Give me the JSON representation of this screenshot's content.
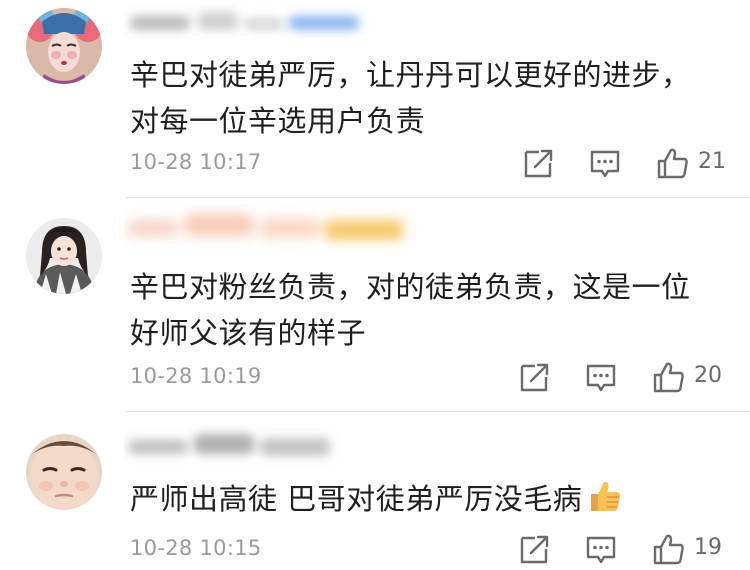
{
  "comments": [
    {
      "text_line1": "辛巴对徒弟严厉，让丹丹可以更好的进步，",
      "text_line2": "对每一位辛选用户负责",
      "time": "10-28 10:17",
      "likes": "21",
      "avatar": "opera-face-avatar"
    },
    {
      "text_line1": "辛巴对粉丝负责，对的徒弟负责，这是一位",
      "text_line2": "好师父该有的样子",
      "time": "10-28 10:19",
      "likes": "20",
      "avatar": "girl-avatar"
    },
    {
      "text_line1": "严师出高徒 巴哥对徒弟严厉没毛病",
      "time": "10-28 10:15",
      "likes": "19",
      "avatar": "baby-avatar",
      "emoji": "thumbs-up-emoji"
    }
  ],
  "icons": {
    "share": "share-icon",
    "reply": "comment-icon",
    "like": "thumbs-up-icon"
  },
  "colors": {
    "text": "#1f1f1f",
    "meta": "#9a9a9a",
    "icon": "#6a6a6a",
    "divider": "#e6e6e6"
  }
}
